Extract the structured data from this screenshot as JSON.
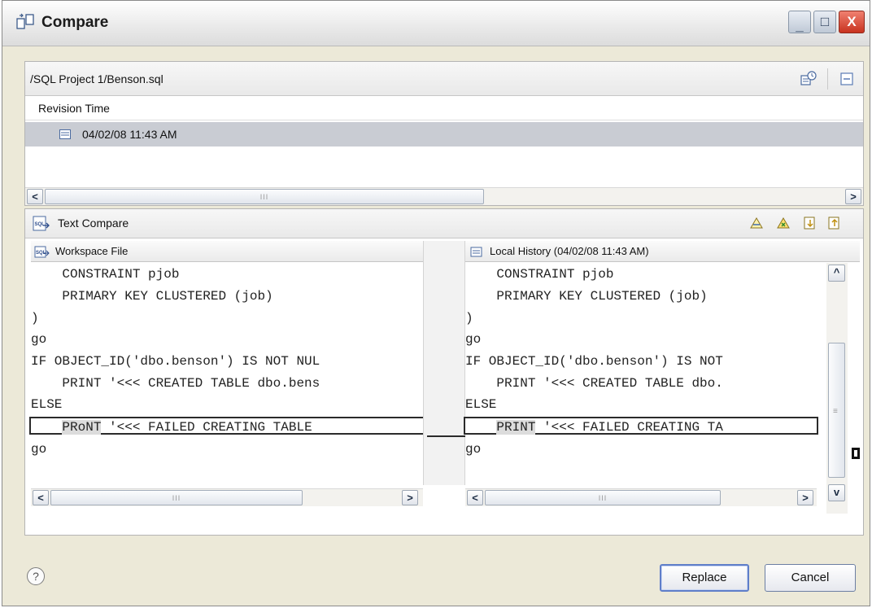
{
  "window": {
    "title": "Compare",
    "min_glyph": "_",
    "max_glyph": "□",
    "close_glyph": "X"
  },
  "history": {
    "path": "/SQL Project 1/Benson.sql",
    "column_header": "Revision Time",
    "revisions": [
      "04/02/08 11:43 AM"
    ]
  },
  "text_compare": {
    "title": "Text Compare",
    "left_pane": {
      "title": "Workspace File",
      "lines": [
        "    CONSTRAINT pjob",
        "    PRIMARY KEY CLUSTERED (job)",
        ")",
        "go",
        "IF OBJECT_ID('dbo.benson') IS NOT NUL",
        "    PRINT '<<< CREATED TABLE dbo.bens",
        "ELSE",
        "    ",
        "go"
      ],
      "diff_keyword": "PRoNT",
      "diff_rest": " '<<< FAILED CREATING TABLE"
    },
    "right_pane": {
      "title": "Local History (04/02/08 11:43 AM)",
      "lines": [
        "    CONSTRAINT pjob",
        "    PRIMARY KEY CLUSTERED (job)",
        ")",
        "go",
        "IF OBJECT_ID('dbo.benson') IS NOT",
        "    PRINT '<<< CREATED TABLE dbo.",
        "ELSE",
        "    ",
        "go"
      ],
      "diff_keyword": "PRINT",
      "diff_rest": " '<<< FAILED CREATING TA"
    }
  },
  "buttons": {
    "help": "?",
    "replace": "Replace",
    "cancel": "Cancel"
  },
  "scroll": {
    "left": "<",
    "right": ">",
    "up": "^",
    "down": "v",
    "h_grip": "III",
    "v_grip": "≡"
  }
}
